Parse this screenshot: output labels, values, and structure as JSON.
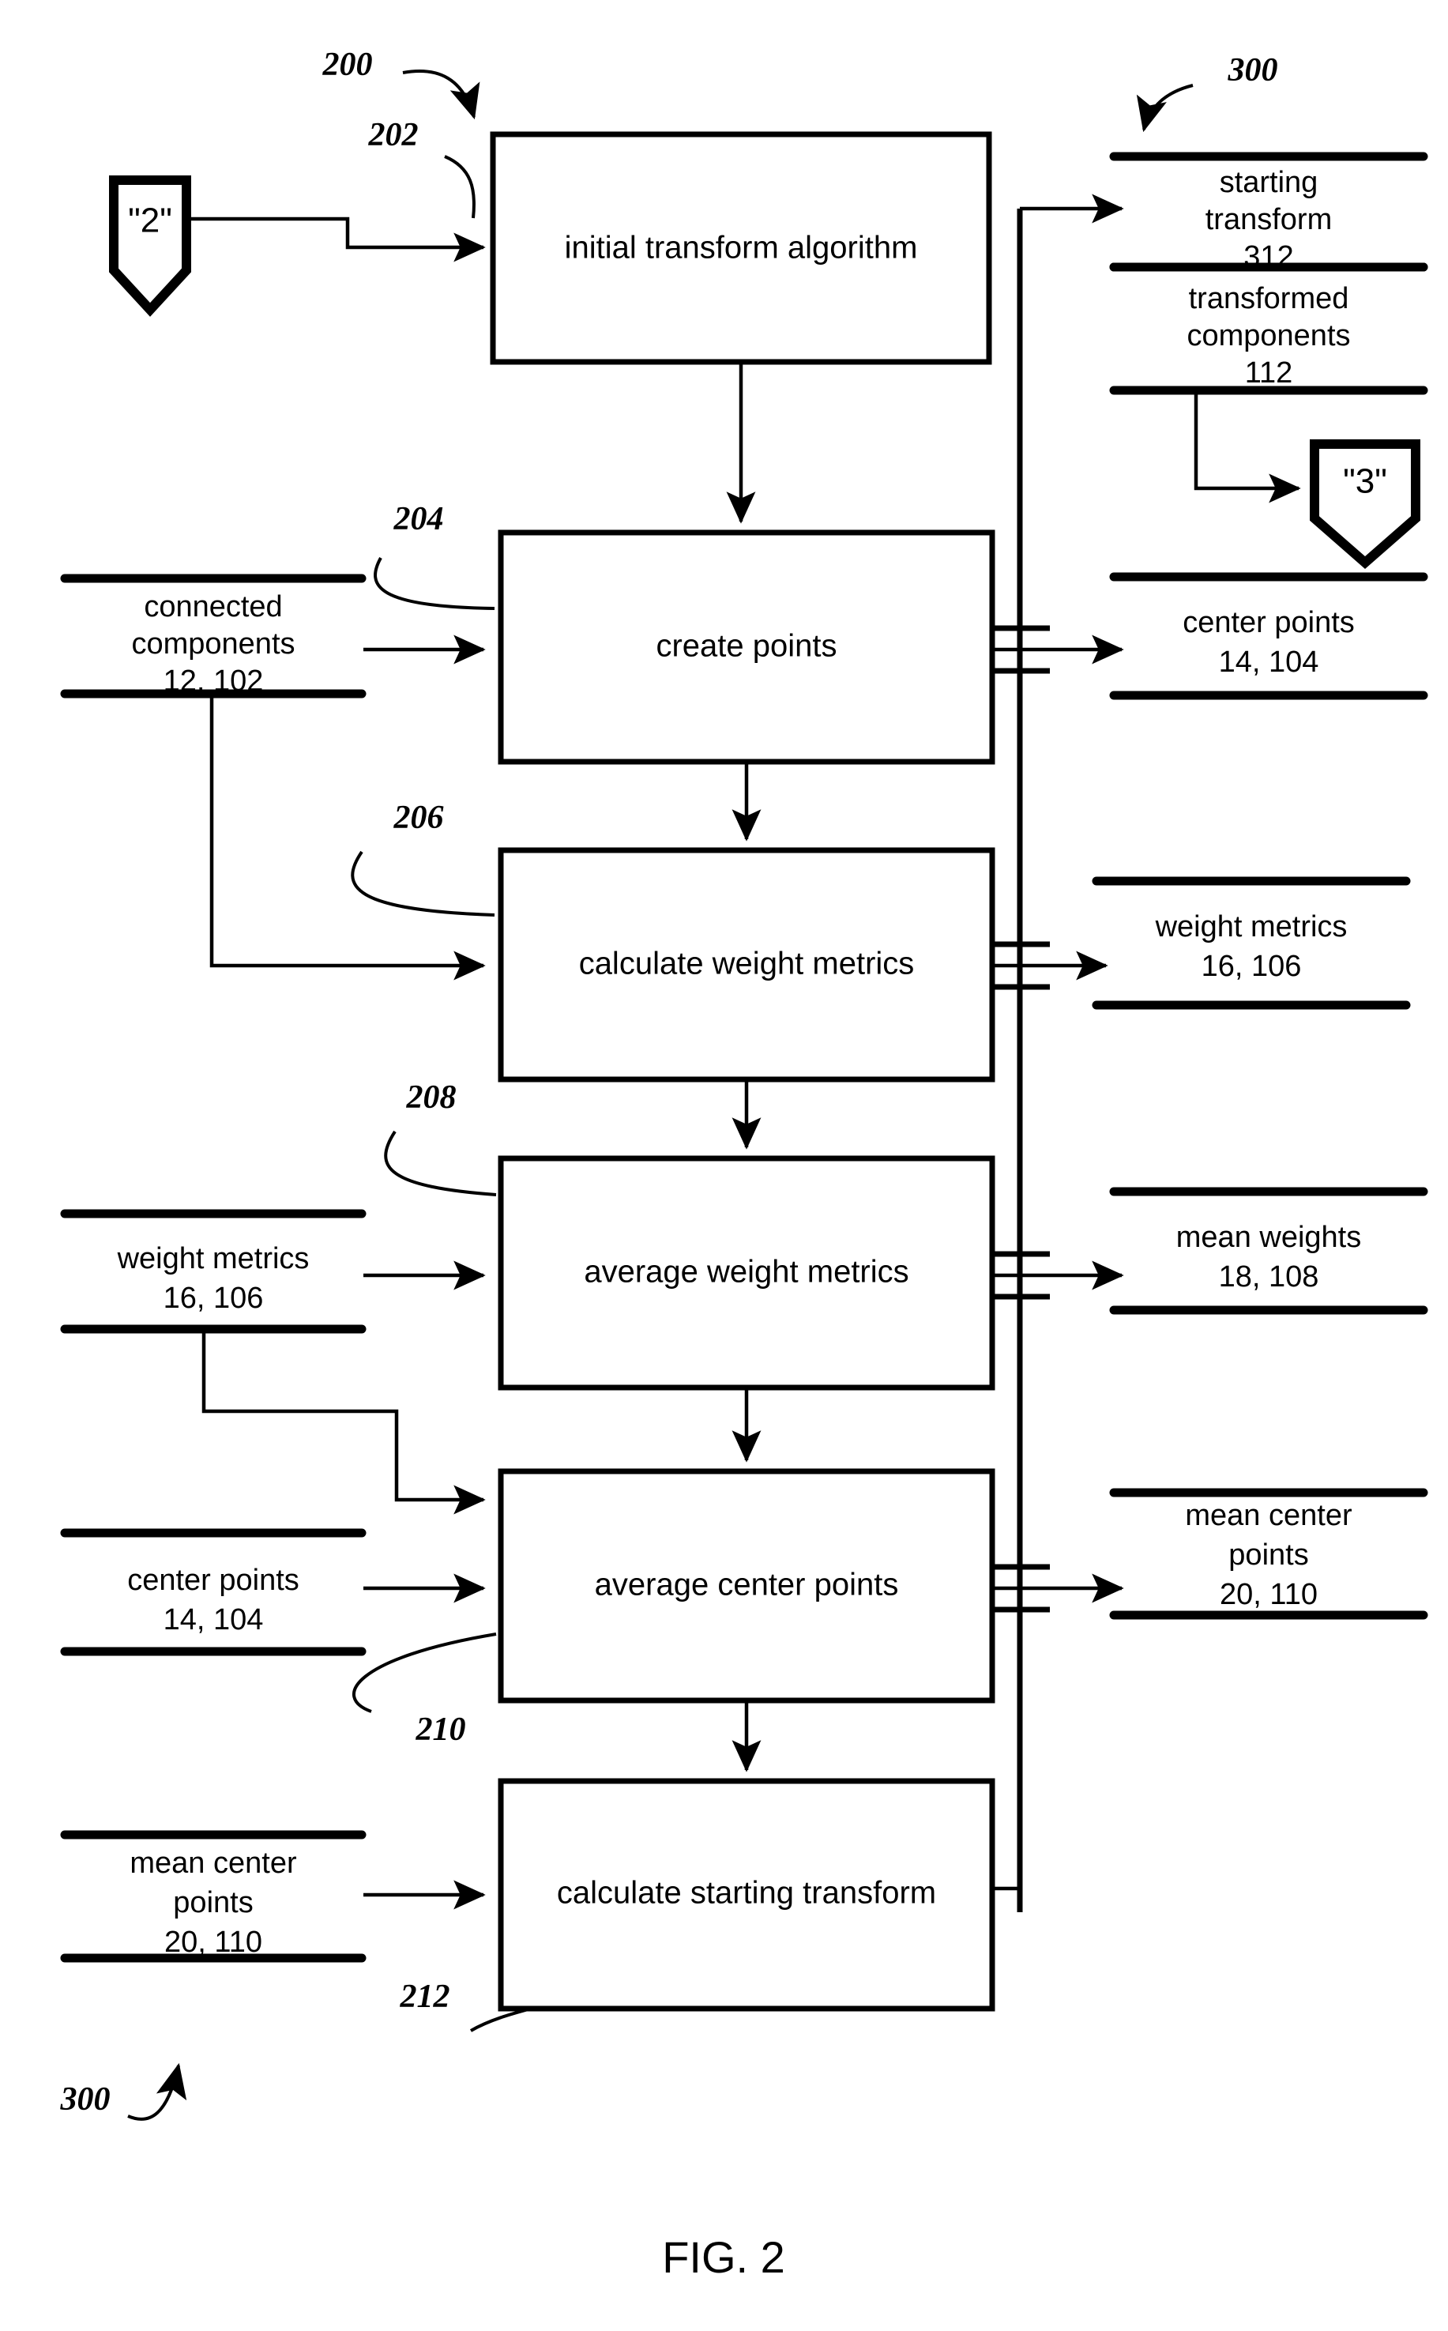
{
  "figure": {
    "caption": "FIG. 2",
    "diagram_ref": "200",
    "return_ref_top": "300",
    "return_ref_bottom": "300"
  },
  "connectors": [
    {
      "id": "conn-2",
      "label": "\"2\"",
      "name": "offpage-connector-2"
    },
    {
      "id": "conn-3",
      "label": "\"3\"",
      "name": "offpage-connector-3"
    }
  ],
  "process_steps": [
    {
      "ref": "202",
      "label": "initial transform algorithm"
    },
    {
      "ref": "204",
      "label": "create points"
    },
    {
      "ref": "206",
      "label": "calculate weight metrics"
    },
    {
      "ref": "208",
      "label": "average weight metrics"
    },
    {
      "ref": "210",
      "label": "average center points"
    },
    {
      "ref": "212",
      "label": "calculate starting transform"
    }
  ],
  "input_data_blocks": [
    {
      "lines": [
        "connected",
        "components",
        "12, 102"
      ]
    },
    {
      "lines": [
        "weight metrics",
        "16, 106"
      ]
    },
    {
      "lines": [
        "center points",
        "14, 104"
      ]
    },
    {
      "lines": [
        "mean center",
        "points",
        "20, 110"
      ]
    }
  ],
  "output_data_blocks": [
    {
      "lines": [
        "starting",
        "transform",
        "312"
      ]
    },
    {
      "lines": [
        "transformed",
        "components",
        "112"
      ]
    },
    {
      "lines": [
        "center points",
        "14, 104"
      ]
    },
    {
      "lines": [
        "weight metrics",
        "16, 106"
      ]
    },
    {
      "lines": [
        "mean weights",
        "18, 108"
      ]
    },
    {
      "lines": [
        "mean center",
        "points",
        "20, 110"
      ]
    }
  ],
  "colors": {
    "ink": "#000000",
    "paper": "#ffffff"
  }
}
